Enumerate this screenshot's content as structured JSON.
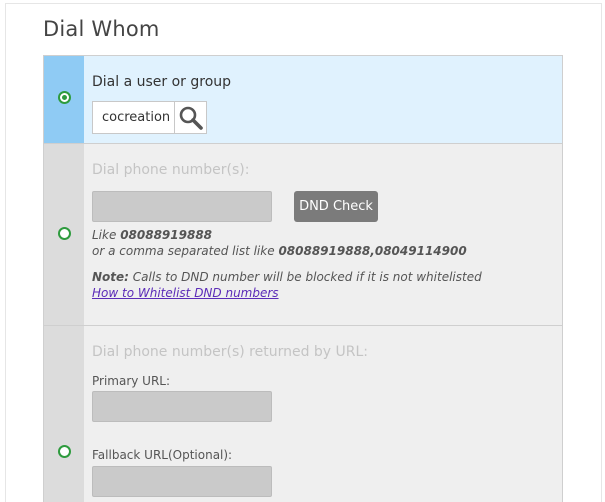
{
  "section": {
    "title": "Dial Whom"
  },
  "options": [
    {
      "id": "user-group",
      "label": "Dial a user or group",
      "selected": true,
      "search_value": "cocreation",
      "search_icon": "magnifier-icon"
    },
    {
      "id": "phone-numbers",
      "label": "Dial phone number(s):",
      "selected": false,
      "input_value": "",
      "dnd_button_label": "DND Check",
      "hint_like_prefix": "Like",
      "hint_like_example": "08088919888",
      "hint_list_prefix": "or a comma separated list like",
      "hint_list_example": "08088919888,08049114900",
      "note_label": "Note:",
      "note_text": "Calls to DND number will be blocked if it is not whitelisted",
      "whitelist_link": "How to Whitelist DND numbers"
    },
    {
      "id": "url",
      "label": "Dial phone number(s) returned by URL:",
      "selected": false,
      "primary_label": "Primary URL:",
      "primary_value": "",
      "fallback_label": "Fallback URL(Optional):",
      "fallback_value": ""
    }
  ],
  "colors": {
    "selected_bg": "#e0f2fe",
    "selected_gutter": "#8fcbf4",
    "radio_green": "#2e9b3e",
    "button_gray": "#7b7b7b",
    "link_purple": "#5b2bb8"
  }
}
